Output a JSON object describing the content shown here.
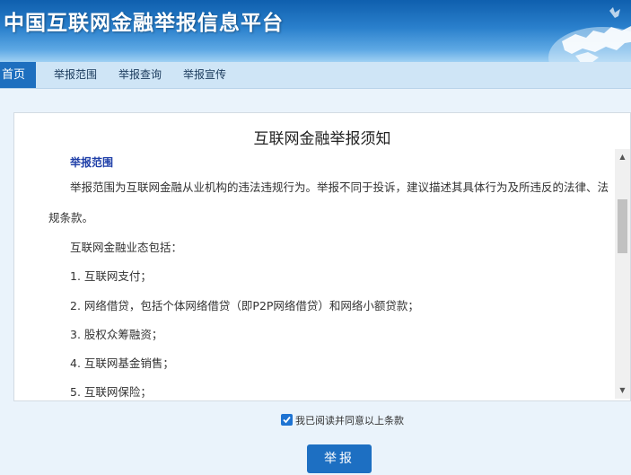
{
  "header": {
    "title": "中国互联网金融举报信息平台"
  },
  "nav": {
    "items": [
      {
        "label": "首页",
        "active": true
      },
      {
        "label": "举报范围",
        "active": false
      },
      {
        "label": "举报查询",
        "active": false
      },
      {
        "label": "举报宣传",
        "active": false
      }
    ]
  },
  "notice": {
    "title": "互联网金融举报须知",
    "section_heading": "举报范围",
    "paragraph1_line1": "举报范围为互联网金融从业机构的违法违规行为。举报不同于投诉，建议描述其具体行为及所违反的法律、法",
    "paragraph1_line2": "规条款。",
    "intro": "互联网金融业态包括：",
    "items": [
      "1. 互联网支付；",
      "2. 网络借贷，包括个体网络借贷（即P2P网络借贷）和网络小额贷款；",
      "3. 股权众筹融资；",
      "4. 互联网基金销售；",
      "5. 互联网保险；"
    ]
  },
  "agreement": {
    "checked": true,
    "label": "我已阅读并同意以上条款"
  },
  "submit": {
    "label": "举报"
  },
  "colors": {
    "brand_blue": "#1e6fbf",
    "heading_blue": "#1f3fa8",
    "page_bg": "#eaf3fb"
  },
  "icons": {
    "checkbox": "check-icon",
    "scroll_up": "scroll-up-arrow-icon",
    "scroll_down": "scroll-down-arrow-icon",
    "banner_graphic": "globe-map-icon"
  }
}
